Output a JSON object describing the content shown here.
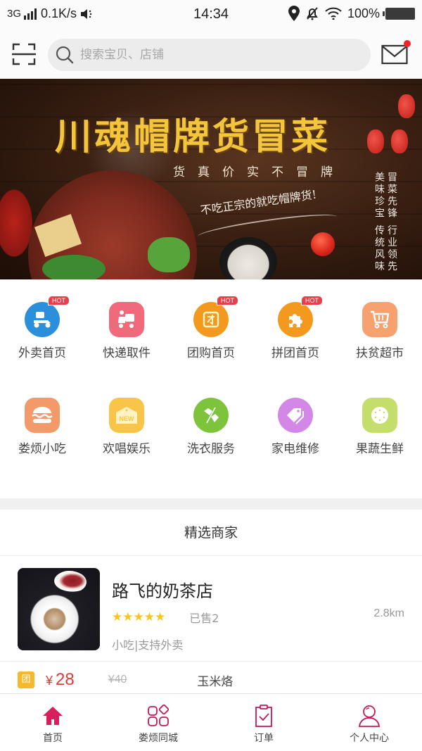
{
  "status_bar": {
    "network_type": "3G",
    "speed": "0.1K/s",
    "time": "14:34",
    "battery": "100%"
  },
  "search": {
    "placeholder": "搜索宝贝、店铺",
    "value": "",
    "has_unread_messages": true
  },
  "banner": {
    "title": "川魂帽牌货冒菜",
    "subtitle": "货真价实不冒牌",
    "slogan": "不吃正宗的就吃帽牌货!",
    "side_col1": "冒菜先锋 行业领先",
    "side_col2": "美味珍宝 传统风味"
  },
  "categories": [
    {
      "label": "外卖首页",
      "icon": "scooter-icon",
      "hot": true,
      "color": "#2b8fdc",
      "shape": "round"
    },
    {
      "label": "快递取件",
      "icon": "courier-icon",
      "hot": false,
      "color": "#f06a7c",
      "shape": "rounded"
    },
    {
      "label": "团购首页",
      "icon": "group-buy-icon",
      "hot": true,
      "color": "#f39a1e",
      "shape": "round"
    },
    {
      "label": "拼团首页",
      "icon": "puzzle-icon",
      "hot": true,
      "color": "#f39a1e",
      "shape": "round"
    },
    {
      "label": "扶贫超市",
      "icon": "cart-icon",
      "hot": false,
      "color": "#f7a070",
      "shape": "rounded"
    },
    {
      "label": "娄烦小吃",
      "icon": "burger-icon",
      "hot": false,
      "color": "#f29a6a",
      "shape": "rounded"
    },
    {
      "label": "欢唱娱乐",
      "icon": "new-tag-icon",
      "hot": false,
      "color": "#f9c548",
      "shape": "rounded"
    },
    {
      "label": "洗衣服务",
      "icon": "laundry-tag-icon",
      "hot": false,
      "color": "#7dc43c",
      "shape": "round"
    },
    {
      "label": "家电维修",
      "icon": "repair-tag-icon",
      "hot": false,
      "color": "#d388e8",
      "shape": "round"
    },
    {
      "label": "果蔬生鲜",
      "icon": "fruit-icon",
      "hot": false,
      "color": "#c5de6b",
      "shape": "rounded"
    }
  ],
  "hot_label": "HOT",
  "new_label": "NEW",
  "section_title": "精选商家",
  "shops": [
    {
      "name": "路飞的奶茶店",
      "rating": 5,
      "rating_max": 5,
      "sold": "已售2",
      "distance": "2.8km",
      "tags": "小吃|支持外卖",
      "deals": [
        {
          "badge": "团",
          "currency": "¥",
          "price": "28",
          "original_price": "¥40",
          "name": "玉米烙"
        }
      ]
    }
  ],
  "tabbar": [
    {
      "label": "首页",
      "icon": "home-icon",
      "active": true
    },
    {
      "label": "娄烦同城",
      "icon": "apps-icon",
      "active": false
    },
    {
      "label": "订单",
      "icon": "clipboard-check-icon",
      "active": false
    },
    {
      "label": "个人中心",
      "icon": "user-icon",
      "active": false
    }
  ],
  "colors": {
    "accent": "#d81e5b",
    "price": "#e23a3a",
    "star": "#f8c51c",
    "hot_badge": "#e8404a",
    "deal_badge": "#f5b92a"
  }
}
